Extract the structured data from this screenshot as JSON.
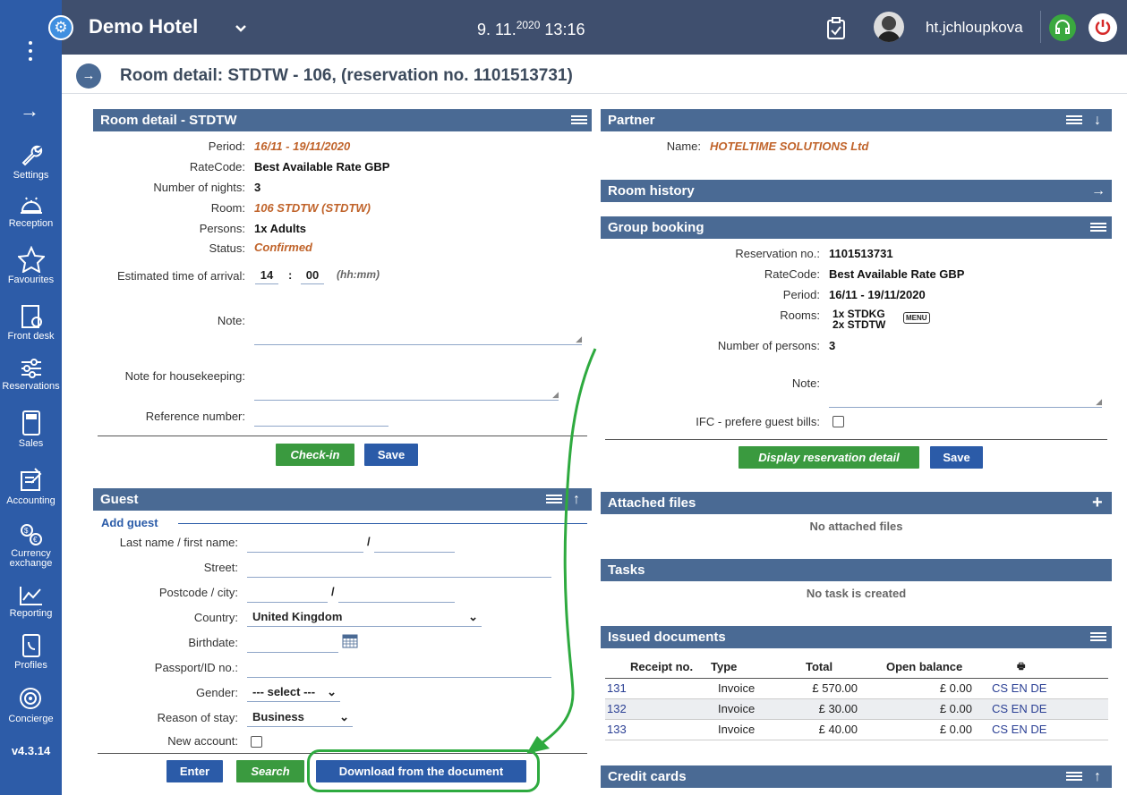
{
  "app": {
    "hotel": "Demo Hotel",
    "date_main": "9. 11.",
    "date_sup": "2020",
    "time": "13:16",
    "user": "ht.jchloupkova",
    "version": "v4.3.14"
  },
  "sidebar": {
    "items": [
      {
        "label": "Settings"
      },
      {
        "label": "Reception"
      },
      {
        "label": "Favourites"
      },
      {
        "label": "Front desk"
      },
      {
        "label": "Reservations"
      },
      {
        "label": "Sales"
      },
      {
        "label": "Accounting"
      },
      {
        "label": "Currency exchange"
      },
      {
        "label": "Reporting"
      },
      {
        "label": "Profiles"
      },
      {
        "label": "Concierge"
      }
    ]
  },
  "page": {
    "title": "Room detail: STDTW - 106, (reservation no. 1101513731)"
  },
  "room_detail": {
    "header": "Room detail - STDTW",
    "period_label": "Period:",
    "period": "16/11 - 19/11/2020",
    "ratecode_label": "RateCode:",
    "ratecode": "Best Available Rate GBP",
    "nights_label": "Number of nights:",
    "nights": "3",
    "room_label": "Room:",
    "room": "106 STDTW (STDTW)",
    "persons_label": "Persons:",
    "persons": "1x Adults",
    "status_label": "Status:",
    "status": "Confirmed",
    "eta_label": "Estimated time of arrival:",
    "eta_h": "14",
    "eta_m": "00",
    "eta_fmt": "(hh:mm)",
    "note_label": "Note:",
    "hk_label": "Note for housekeeping:",
    "ref_label": "Reference number:",
    "checkin": "Check-in",
    "save": "Save"
  },
  "guest": {
    "header": "Guest",
    "add": "Add guest",
    "lastname_label": "Last name / first name:",
    "street_label": "Street:",
    "postcode_label": "Postcode / city:",
    "country_label": "Country:",
    "country": "United Kingdom",
    "birthdate_label": "Birthdate:",
    "passport_label": "Passport/ID no.:",
    "gender_label": "Gender:",
    "gender": "--- select ---",
    "reason_label": "Reason of stay:",
    "reason": "Business",
    "newaccount_label": "New account:",
    "enter": "Enter",
    "search": "Search",
    "download": "Download from the document",
    "slash": "/"
  },
  "partner": {
    "header": "Partner",
    "name_label": "Name:",
    "name": "HOTELTIME SOLUTIONS Ltd"
  },
  "room_history": {
    "header": "Room history"
  },
  "group": {
    "header": "Group booking",
    "resno_label": "Reservation no.:",
    "resno": "1101513731",
    "ratecode_label": "RateCode:",
    "ratecode": "Best Available Rate GBP",
    "period_label": "Period:",
    "period": "16/11 - 19/11/2020",
    "rooms_label": "Rooms:",
    "rooms1": "1x STDKG",
    "rooms2": "2x STDTW",
    "menu": "MENU",
    "persons_label": "Number of persons:",
    "persons": "3",
    "note_label": "Note:",
    "ifc_label": "IFC - prefere guest bills:",
    "display": "Display reservation detail",
    "save": "Save"
  },
  "attached": {
    "header": "Attached files",
    "empty": "No attached files"
  },
  "tasks": {
    "header": "Tasks",
    "empty": "No task is created"
  },
  "issued": {
    "header": "Issued documents",
    "cols": [
      "Receipt no.",
      "Type",
      "Total",
      "Open balance"
    ],
    "rows": [
      {
        "no": "131",
        "type": "Invoice",
        "total": "£ 570.00",
        "balance": "£ 0.00",
        "langs": "CS EN DE"
      },
      {
        "no": "132",
        "type": "Invoice",
        "total": "£ 30.00",
        "balance": "£ 0.00",
        "langs": "CS EN DE"
      },
      {
        "no": "133",
        "type": "Invoice",
        "total": "£ 40.00",
        "balance": "£ 0.00",
        "langs": "CS EN DE"
      }
    ]
  },
  "credit": {
    "header": "Credit cards"
  }
}
